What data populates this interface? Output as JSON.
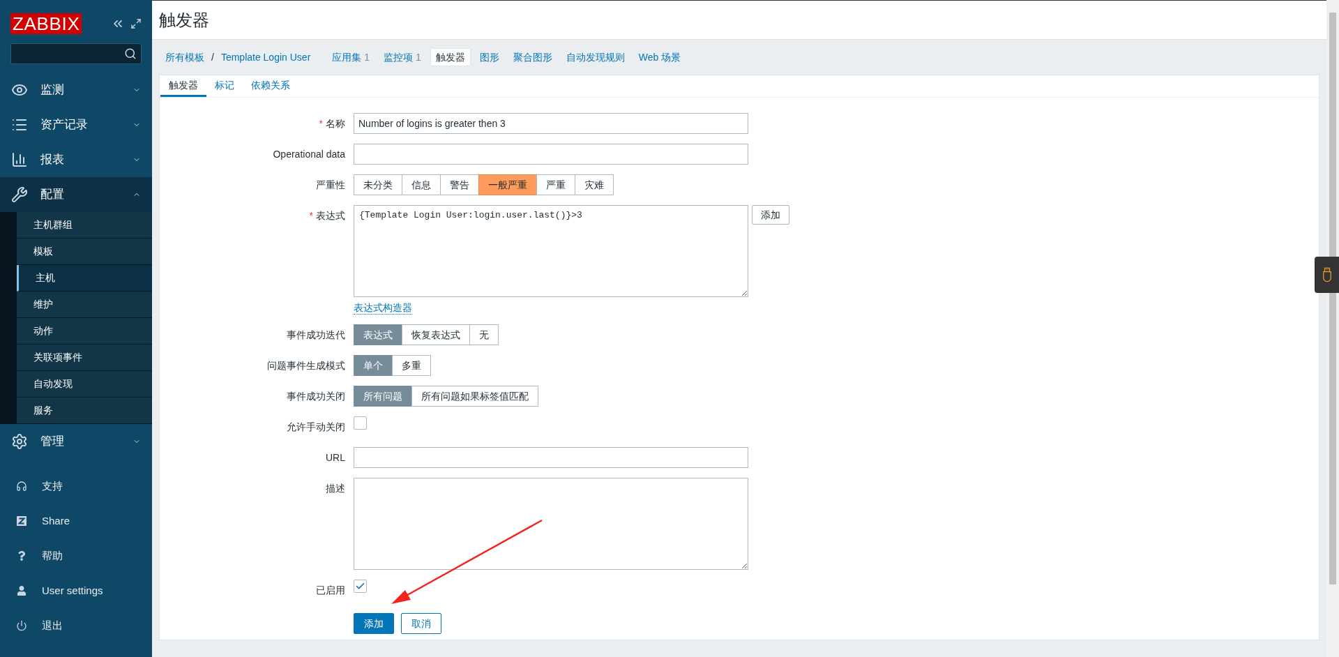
{
  "sidebar": {
    "logo": "ZABBIX",
    "menu": [
      {
        "label": "监测",
        "expanded": false
      },
      {
        "label": "资产记录",
        "expanded": false
      },
      {
        "label": "报表",
        "expanded": false
      },
      {
        "label": "配置",
        "expanded": true,
        "children": [
          {
            "label": "主机群组",
            "selected": false
          },
          {
            "label": "模板",
            "selected": false
          },
          {
            "label": "主机",
            "selected": true
          },
          {
            "label": "维护",
            "selected": false
          },
          {
            "label": "动作",
            "selected": false
          },
          {
            "label": "关联项事件",
            "selected": false
          },
          {
            "label": "自动发现",
            "selected": false
          },
          {
            "label": "服务",
            "selected": false
          }
        ]
      },
      {
        "label": "管理",
        "expanded": false
      }
    ],
    "links": [
      {
        "label": "支持"
      },
      {
        "label": "Share"
      },
      {
        "label": "帮助"
      },
      {
        "label": "User settings"
      },
      {
        "label": "退出"
      }
    ]
  },
  "page": {
    "title": "触发器"
  },
  "breadcrumb": {
    "items": [
      "所有模板",
      "Template Login User"
    ],
    "separator": "/"
  },
  "nav_tabs": [
    {
      "label": "应用集",
      "count": "1",
      "selected": false
    },
    {
      "label": "监控项",
      "count": "1",
      "selected": false
    },
    {
      "label": "触发器",
      "selected": true
    },
    {
      "label": "图形",
      "selected": false
    },
    {
      "label": "聚合图形",
      "selected": false
    },
    {
      "label": "自动发现规则",
      "selected": false
    },
    {
      "label": "Web 场景",
      "selected": false
    }
  ],
  "form_tabs": [
    {
      "label": "触发器",
      "selected": true
    },
    {
      "label": "标记",
      "selected": false
    },
    {
      "label": "依赖关系",
      "selected": false
    }
  ],
  "fields": [
    {
      "kind": "text",
      "label": "名称",
      "marker": "*",
      "value": "Number of logins is greater then 3"
    },
    {
      "kind": "text",
      "label": "Operational data"
    },
    {
      "kind": "severity",
      "label": "严重性",
      "options": [
        {
          "label": "未分类",
          "selected": false
        },
        {
          "label": "信息",
          "selected": false
        },
        {
          "label": "警告",
          "selected": false
        },
        {
          "label": "一般严重",
          "selected": true
        },
        {
          "label": "严重",
          "selected": false
        },
        {
          "label": "灾难",
          "selected": false
        }
      ]
    },
    {
      "kind": "expression",
      "label": "表达式",
      "marker": "*",
      "value": "{Template Login User:login.user.last()}>3",
      "button": "添加",
      "link": "表达式构造器"
    },
    {
      "kind": "segmented",
      "label": "事件成功迭代",
      "options": [
        {
          "label": "表达式",
          "selected": true
        },
        {
          "label": "恢复表达式",
          "selected": false
        },
        {
          "label": "无",
          "selected": false
        }
      ]
    },
    {
      "kind": "segmented",
      "label": "问题事件生成模式",
      "options": [
        {
          "label": "单个",
          "selected": true
        },
        {
          "label": "多重",
          "selected": false
        }
      ]
    },
    {
      "kind": "segmented",
      "label": "事件成功关闭",
      "options": [
        {
          "label": "所有问题",
          "selected": true
        },
        {
          "label": "所有问题如果标签值匹配",
          "selected": false
        }
      ]
    },
    {
      "kind": "checkbox",
      "label": "允许手动关闭",
      "checked": false
    },
    {
      "kind": "text",
      "label": "URL"
    },
    {
      "kind": "textarea",
      "label": "描述"
    },
    {
      "kind": "checkbox",
      "label": "已启用",
      "checked": true
    }
  ],
  "buttons": [
    {
      "label": "添加",
      "primary": true
    },
    {
      "label": "取消",
      "primary": false
    }
  ]
}
